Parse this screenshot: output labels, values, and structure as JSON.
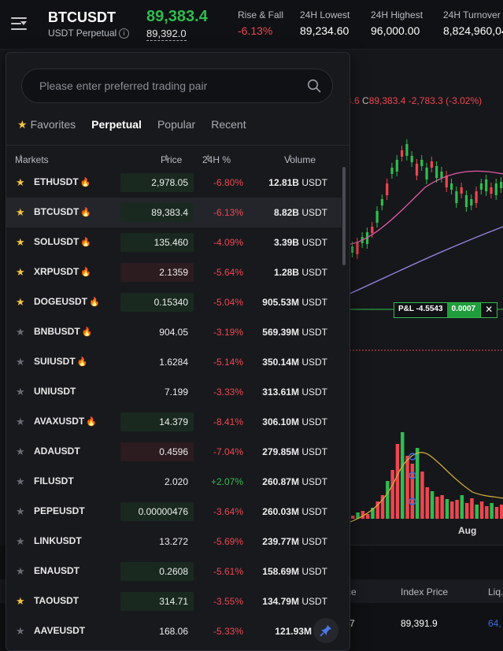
{
  "header": {
    "symbol": "BTCUSDT",
    "subtitle": "USDT Perpetual",
    "info_icon": "info-icon",
    "last_price": "89,383.4",
    "mark_price": "89,392.0",
    "stats": [
      {
        "label": "Rise & Fall",
        "value": "-6.13%",
        "negative": true
      },
      {
        "label": "24H Lowest",
        "value": "89,234.60"
      },
      {
        "label": "24H Highest",
        "value": "96,000.00"
      },
      {
        "label": "24H Turnover",
        "value": "8,824,960,04"
      }
    ]
  },
  "chart": {
    "ohlc_prefix": "4.6",
    "close_label": "C",
    "close_value": "89,383.4",
    "change": "-2,783.3 (-3.02%)",
    "pnl_label": "P&L -4.5543",
    "pnl_qty": "0.0007",
    "x_tick": "Aug",
    "colors": {
      "up": "#2fbd4f",
      "down": "#f0454f",
      "ma1": "#e05aa8",
      "ma2": "#9b86e8",
      "vol_ma": "#d9b43a"
    }
  },
  "bottom_table": {
    "headers": [
      "ce",
      "Index Price",
      "Liq."
    ],
    "row": [
      "7",
      "89,391.9",
      "64,"
    ]
  },
  "popup": {
    "search_placeholder": "Please enter preferred trading pair",
    "tabs": [
      "Favorites",
      "Perpetual",
      "Popular",
      "Recent"
    ],
    "active_tab": "Perpetual",
    "columns": {
      "markets": "Markets",
      "price": "Price",
      "change": "24H %",
      "volume": "Volume"
    },
    "markets": [
      {
        "name": "ETHUSDT",
        "hot": true,
        "fav": true,
        "price": "2,978.05",
        "change": "-6.80%",
        "volume": "12.81B",
        "unit": "USDT",
        "flash": "g"
      },
      {
        "name": "BTCUSDT",
        "hot": true,
        "fav": true,
        "price": "89,383.4",
        "change": "-6.13%",
        "volume": "8.82B",
        "unit": "USDT",
        "flash": "g",
        "selected": true
      },
      {
        "name": "SOLUSDT",
        "hot": true,
        "fav": true,
        "price": "135.460",
        "change": "-4.09%",
        "volume": "3.39B",
        "unit": "USDT",
        "flash": "g"
      },
      {
        "name": "XRPUSDT",
        "hot": true,
        "fav": true,
        "price": "2.1359",
        "change": "-5.64%",
        "volume": "1.28B",
        "unit": "USDT",
        "flash": "r"
      },
      {
        "name": "DOGEUSDT",
        "hot": true,
        "fav": true,
        "price": "0.15340",
        "change": "-5.04%",
        "volume": "905.53M",
        "unit": "USDT",
        "flash": "g"
      },
      {
        "name": "BNBUSDT",
        "hot": true,
        "fav": false,
        "price": "904.05",
        "change": "-3.19%",
        "volume": "569.39M",
        "unit": "USDT",
        "flash": ""
      },
      {
        "name": "SUIUSDT",
        "hot": true,
        "fav": false,
        "price": "1.6284",
        "change": "-5.14%",
        "volume": "350.14M",
        "unit": "USDT",
        "flash": ""
      },
      {
        "name": "UNIUSDT",
        "hot": false,
        "fav": false,
        "price": "7.199",
        "change": "-3.33%",
        "volume": "313.61M",
        "unit": "USDT",
        "flash": ""
      },
      {
        "name": "AVAXUSDT",
        "hot": true,
        "fav": false,
        "price": "14.379",
        "change": "-8.41%",
        "volume": "306.10M",
        "unit": "USDT",
        "flash": "g"
      },
      {
        "name": "ADAUSDT",
        "hot": false,
        "fav": false,
        "price": "0.4596",
        "change": "-7.04%",
        "volume": "279.85M",
        "unit": "USDT",
        "flash": "r"
      },
      {
        "name": "FILUSDT",
        "hot": false,
        "fav": false,
        "price": "2.020",
        "change": "+2.07%",
        "volume": "260.87M",
        "unit": "USDT",
        "flash": ""
      },
      {
        "name": "PEPEUSDT",
        "hot": false,
        "fav": false,
        "price": "0.00000476",
        "change": "-3.64%",
        "volume": "260.03M",
        "unit": "USDT",
        "flash": "g"
      },
      {
        "name": "LINKUSDT",
        "hot": false,
        "fav": false,
        "price": "13.272",
        "change": "-5.69%",
        "volume": "239.77M",
        "unit": "USDT",
        "flash": ""
      },
      {
        "name": "ENAUSDT",
        "hot": false,
        "fav": false,
        "price": "0.2608",
        "change": "-5.61%",
        "volume": "158.69M",
        "unit": "USDT",
        "flash": "g"
      },
      {
        "name": "TAOUSDT",
        "hot": false,
        "fav": true,
        "price": "314.71",
        "change": "-3.55%",
        "volume": "134.79M",
        "unit": "USDT",
        "flash": "g"
      },
      {
        "name": "AAVEUSDT",
        "hot": false,
        "fav": false,
        "price": "168.06",
        "change": "-5.33%",
        "volume": "121.93M",
        "unit": "US",
        "flash": ""
      }
    ]
  }
}
